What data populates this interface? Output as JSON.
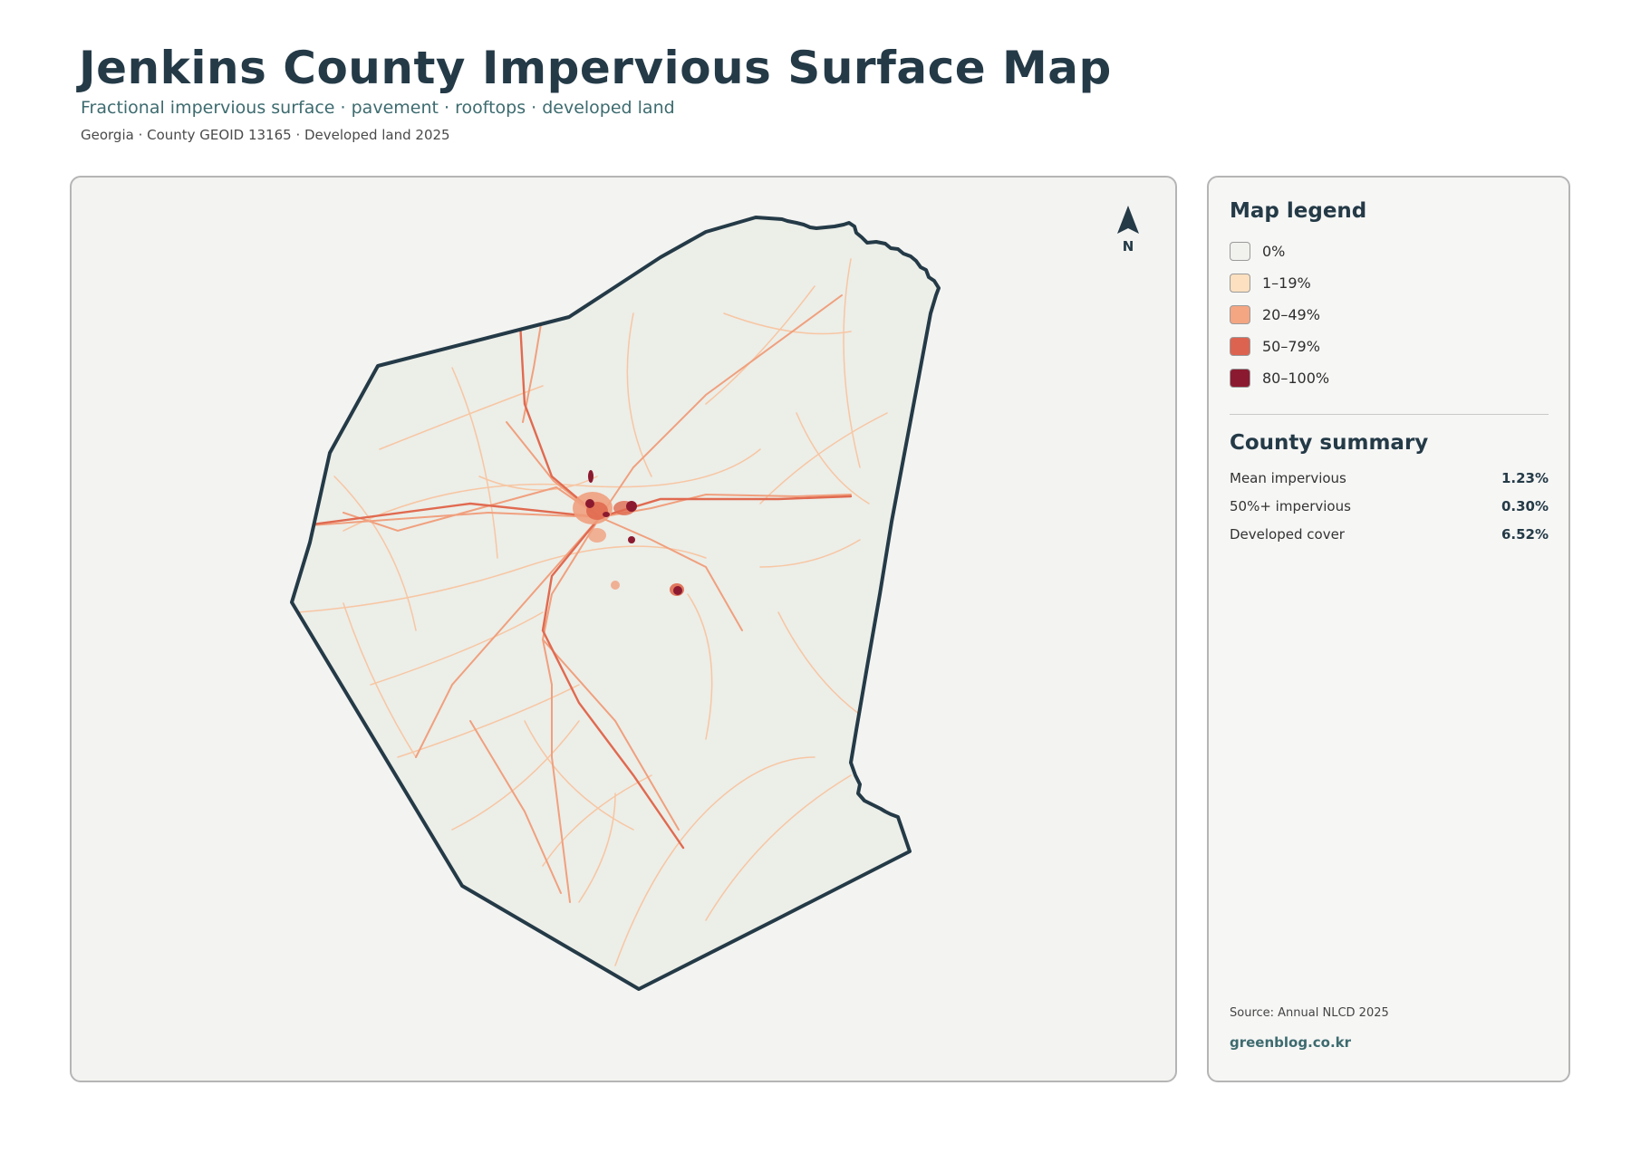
{
  "header": {
    "title": "Jenkins County Impervious Surface Map",
    "subtitle": "Fractional impervious surface · pavement · rooftops · developed land",
    "meta": "Georgia · County GEOID 13165 · Developed land 2025"
  },
  "map": {
    "north_label": "N",
    "land_color": "#eceee8",
    "boundary_color": "#243a47",
    "road_colors": [
      "#f7c6a3",
      "#f0a07e",
      "#e06a50"
    ],
    "urban_color": "#8b1a30"
  },
  "legend": {
    "title": "Map legend",
    "items": [
      {
        "label": "0%",
        "color": "#f1f1ee"
      },
      {
        "label": "1–19%",
        "color": "#fde0c0"
      },
      {
        "label": "20–49%",
        "color": "#f4a582"
      },
      {
        "label": "50–79%",
        "color": "#dc6350"
      },
      {
        "label": "80–100%",
        "color": "#8b1a30"
      }
    ]
  },
  "summary": {
    "title": "County summary",
    "stats": [
      {
        "label": "Mean impervious",
        "value": "1.23%"
      },
      {
        "label": "50%+ impervious",
        "value": "0.30%"
      },
      {
        "label": "Developed cover",
        "value": "6.52%"
      }
    ]
  },
  "footer": {
    "source": "Source: Annual NLCD 2025",
    "site": "greenblog.co.kr"
  }
}
